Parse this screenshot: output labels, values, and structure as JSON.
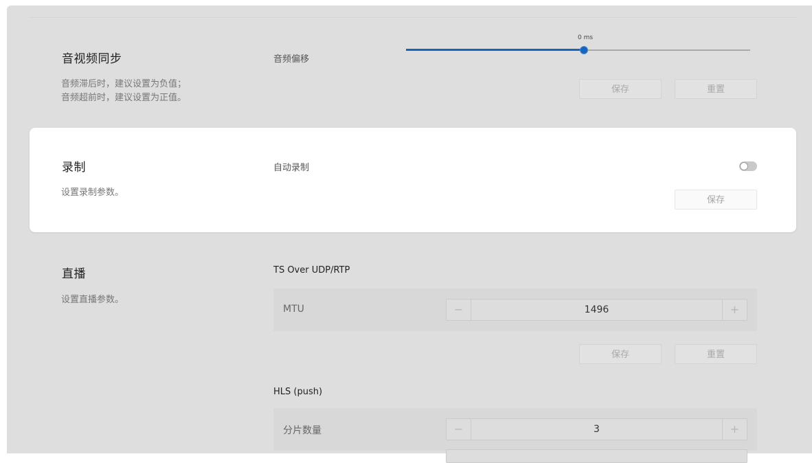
{
  "av_sync": {
    "title": "音视频同步",
    "desc_line1": "音频滞后时，建议设置为负值；",
    "desc_line2": "音频超前时，建议设置为正值。",
    "field_label": "音频偏移",
    "slider_value_text": "0 ms",
    "slider_fraction": 0.5,
    "save_label": "保存",
    "reset_label": "重置"
  },
  "recording": {
    "title": "录制",
    "desc": "设置录制参数。",
    "field_label": "自动录制",
    "auto_record_enabled": false,
    "save_label": "保存"
  },
  "live": {
    "title": "直播",
    "desc": "设置直播参数。",
    "ts_section_label": "TS Over UDP/RTP",
    "mtu_label": "MTU",
    "mtu_value": "1496",
    "save_label": "保存",
    "reset_label": "重置",
    "hls_section_label": "HLS (push)",
    "segments_label": "分片数量",
    "segments_value": "3",
    "minus_symbol": "−",
    "plus_symbol": "+"
  },
  "colors": {
    "accent": "#1565c0",
    "dim_background": "#dedede",
    "card_background": "#ffffff"
  }
}
